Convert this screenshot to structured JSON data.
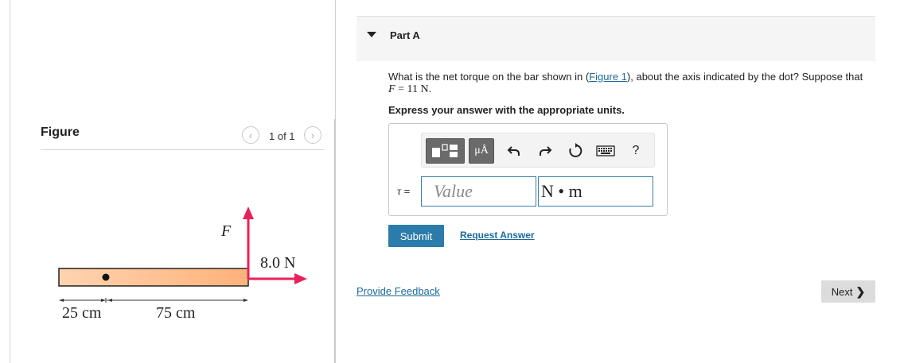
{
  "figure_panel": {
    "title": "Figure",
    "pager": {
      "prev_icon": "chevron-left-icon",
      "label": "1 of 1",
      "next_icon": "chevron-right-icon"
    },
    "diagram": {
      "force_label": "F",
      "horizontal_force_label": "8.0 N",
      "dim_left": "25 cm",
      "dim_right": "75 cm",
      "bar_color": "#ffbe8a",
      "arrow_color": "#e8215a"
    }
  },
  "part": {
    "title": "Part A",
    "question": {
      "text_before_link": "What is the net torque on the bar shown in (",
      "link_text": "Figure 1",
      "text_after_link": "), about the axis indicated by the dot? Suppose that",
      "var": "F",
      "equals": " = 11 ",
      "unit": "N",
      "period": "."
    },
    "instruction": "Express your answer with the appropriate units.",
    "toolbar": {
      "units_label": "μÅ",
      "undo_icon": "undo-icon",
      "redo_icon": "redo-icon",
      "reset_icon": "reset-icon",
      "keyboard_icon": "keyboard-icon",
      "help_label": "?"
    },
    "answer": {
      "symbol": "τ",
      "equals": " =",
      "value_placeholder": "Value",
      "units_value": "N • m"
    },
    "submit_label": "Submit",
    "request_label": "Request Answer"
  },
  "footer": {
    "feedback_label": "Provide Feedback",
    "next_label": "Next"
  }
}
